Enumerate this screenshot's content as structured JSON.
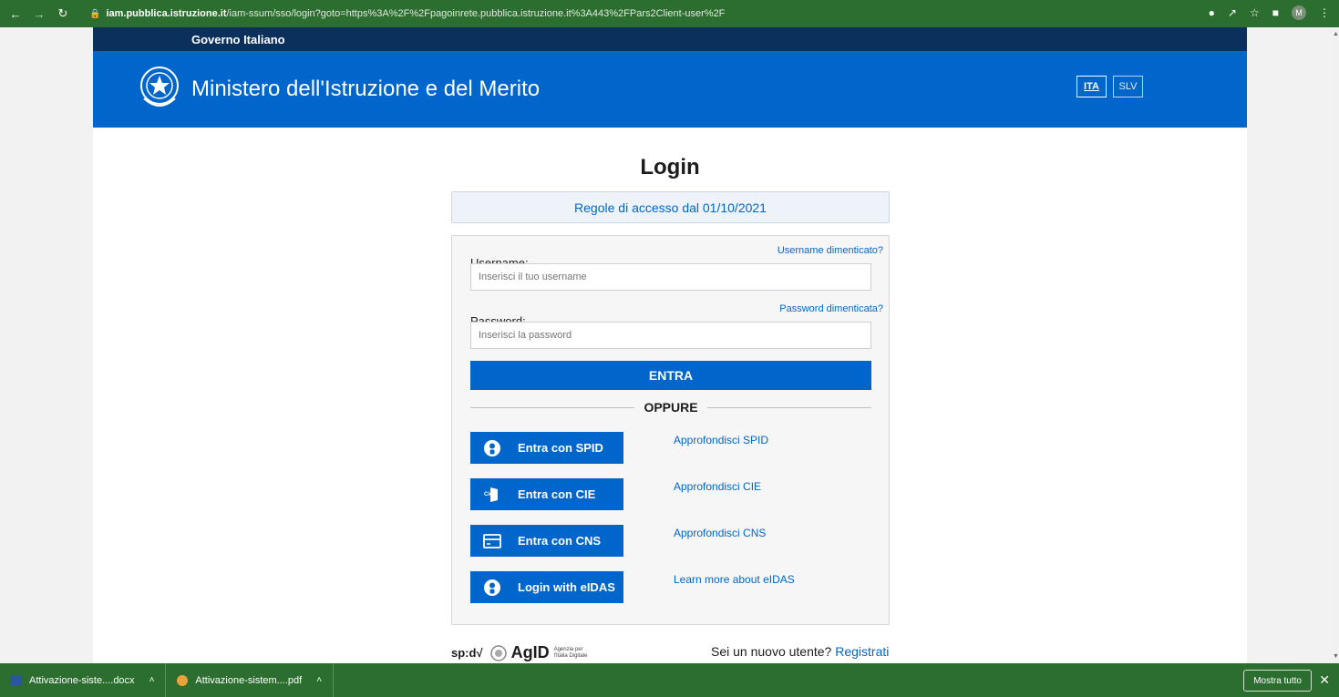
{
  "browser": {
    "url_host": "iam.pubblica.istruzione.it",
    "url_path": "/iam-ssum/sso/login?goto=https%3A%2F%2Fpagoinrete.pubblica.istruzione.it%3A443%2FPars2Client-user%2F",
    "profile_initial": "M"
  },
  "gov_bar": {
    "label": "Governo Italiano"
  },
  "header": {
    "ministry": "Ministero dell'Istruzione e del Merito",
    "lang_active": "ITA",
    "lang_other": "SLV"
  },
  "login": {
    "title": "Login",
    "rules": "Regole di accesso dal 01/10/2021",
    "username_label": "Username:",
    "username_forgot": "Username dimenticato?",
    "username_placeholder": "Inserisci il tuo username",
    "password_label": "Password:",
    "password_forgot": "Password dimenticata?",
    "password_placeholder": "Inserisci la password",
    "submit": "ENTRA",
    "separator": "OPPURE"
  },
  "sso": [
    {
      "label": "Entra con SPID",
      "more": "Approfondisci SPID"
    },
    {
      "label": "Entra con CIE",
      "more": "Approfondisci CIE"
    },
    {
      "label": "Entra con CNS",
      "more": "Approfondisci CNS"
    },
    {
      "label": "Login with eIDAS",
      "more": "Learn more about eIDAS"
    }
  ],
  "footer": {
    "spid_logo": "sp:d√",
    "agid": "AgID",
    "agid_sub_1": "Agenzia per",
    "agid_sub_2": "l'Italia Digitale",
    "new_user": "Sei un nuovo utente?",
    "register": "Registrati"
  },
  "downloads": {
    "item1": "Attivazione-siste....docx",
    "item2": "Attivazione-sistem....pdf",
    "show_all": "Mostra tutto"
  },
  "colors": {
    "primary": "#0066cc",
    "gov_bar": "#0b305c",
    "chrome": "#2c6e2f"
  }
}
